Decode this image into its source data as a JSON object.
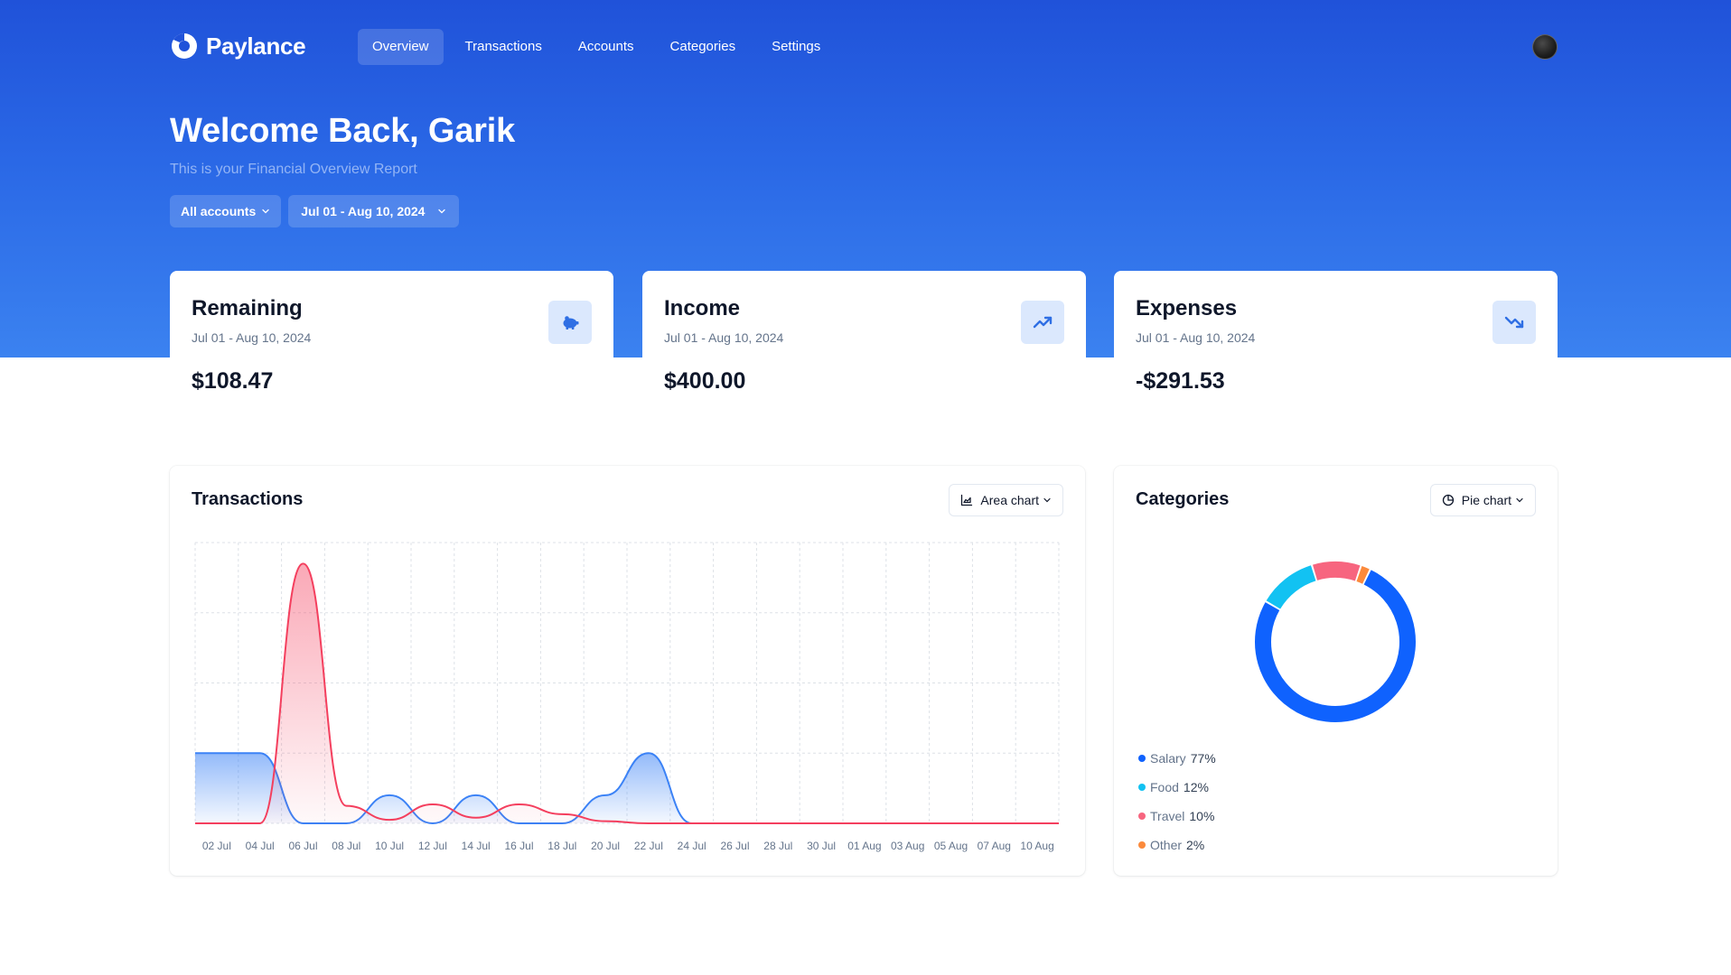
{
  "brand": {
    "name": "Paylance"
  },
  "nav": {
    "items": [
      {
        "label": "Overview",
        "active": true
      },
      {
        "label": "Transactions",
        "active": false
      },
      {
        "label": "Accounts",
        "active": false
      },
      {
        "label": "Categories",
        "active": false
      },
      {
        "label": "Settings",
        "active": false
      }
    ]
  },
  "header": {
    "title": "Welcome Back, Garik",
    "subtitle": "This is your Financial Overview Report"
  },
  "filters": {
    "account": "All accounts",
    "date_range": "Jul 01 - Aug 10, 2024"
  },
  "stats": {
    "remaining": {
      "title": "Remaining",
      "date": "Jul 01 - Aug 10, 2024",
      "value": "$108.47",
      "icon": "piggy-bank-icon"
    },
    "income": {
      "title": "Income",
      "date": "Jul 01 - Aug 10, 2024",
      "value": "$400.00",
      "icon": "trending-up-icon"
    },
    "expenses": {
      "title": "Expenses",
      "date": "Jul 01 - Aug 10, 2024",
      "value": "-$291.53",
      "icon": "trending-down-icon"
    }
  },
  "transactions": {
    "title": "Transactions",
    "chart_type_label": "Area chart"
  },
  "categories": {
    "title": "Categories",
    "chart_type_label": "Pie chart"
  },
  "colors": {
    "income": "#3b82f6",
    "expenses": "#f43f5e",
    "salary": "#0f62fe",
    "food": "#12c2f2",
    "travel": "#f7657f",
    "other": "#fb8a3c"
  },
  "chart_data": [
    {
      "type": "area",
      "title": "Transactions",
      "x": [
        "02 Jul",
        "04 Jul",
        "06 Jul",
        "08 Jul",
        "10 Jul",
        "12 Jul",
        "14 Jul",
        "16 Jul",
        "18 Jul",
        "20 Jul",
        "22 Jul",
        "24 Jul",
        "26 Jul",
        "28 Jul",
        "30 Jul",
        "01 Aug",
        "03 Aug",
        "05 Aug",
        "07 Aug",
        "10 Aug"
      ],
      "series": [
        {
          "name": "income",
          "values": [
            100,
            100,
            0,
            0,
            40,
            0,
            40,
            0,
            0,
            40,
            100,
            0,
            0,
            0,
            0,
            0,
            0,
            0,
            0,
            0
          ]
        },
        {
          "name": "expenses",
          "values": [
            0,
            0,
            370,
            25,
            5,
            27,
            8,
            27,
            13,
            3,
            0,
            0,
            0,
            0,
            0,
            0,
            0,
            0,
            0,
            0
          ]
        }
      ],
      "grid": true
    },
    {
      "type": "pie",
      "title": "Categories",
      "categories": [
        "Salary",
        "Food",
        "Travel",
        "Other"
      ],
      "values": [
        77,
        12,
        10,
        2
      ],
      "labels": [
        "77%",
        "12%",
        "10%",
        "2%"
      ]
    }
  ]
}
